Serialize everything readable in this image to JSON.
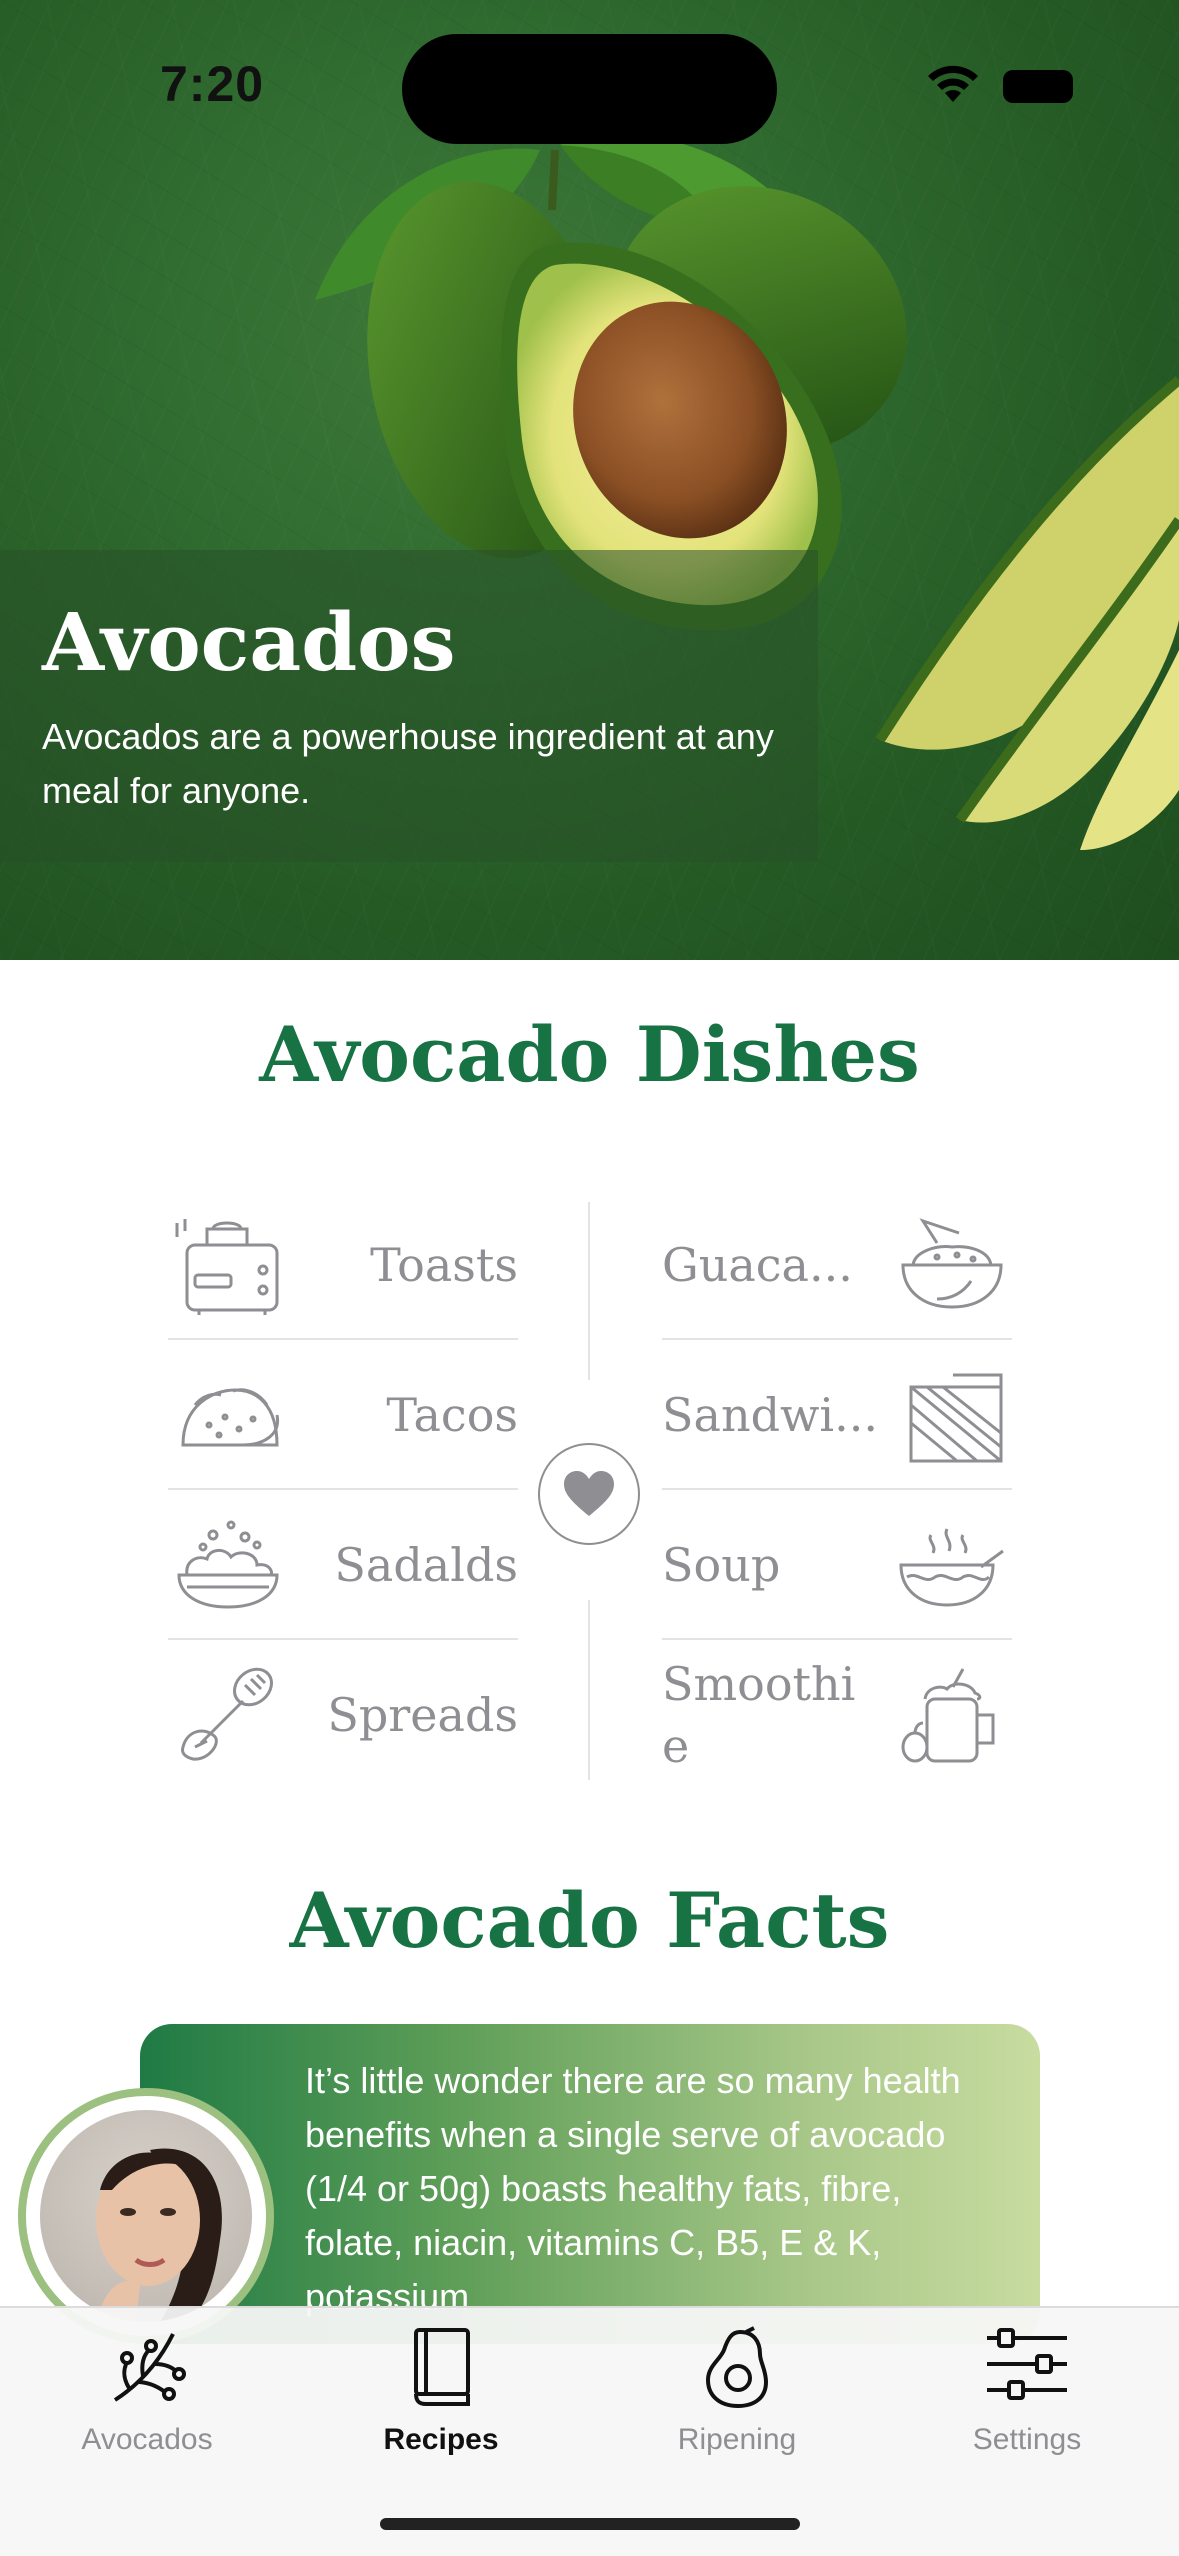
{
  "status_bar": {
    "time": "7:20"
  },
  "hero": {
    "title": "Avocados",
    "description": "Avocados are a powerhouse ingredient at any meal for anyone."
  },
  "dishes": {
    "title": "Avocado Dishes",
    "left": [
      {
        "label": "Toasts",
        "icon": "toaster-icon"
      },
      {
        "label": "Tacos",
        "icon": "taco-icon"
      },
      {
        "label": "Sadalds",
        "icon": "salad-bowl-icon"
      },
      {
        "label": "Spreads",
        "icon": "spread-knife-icon"
      }
    ],
    "right": [
      {
        "label": "Guaca...",
        "icon": "guacamole-bowl-icon"
      },
      {
        "label": "Sandwi...",
        "icon": "sandwich-icon"
      },
      {
        "label": "Soup",
        "icon": "soup-bowl-icon"
      },
      {
        "label": "Smoothi e",
        "icon": "smoothie-jar-icon"
      }
    ],
    "center_icon": "heart-icon"
  },
  "facts": {
    "title": "Avocado Facts",
    "text": "It’s little wonder there are so many health benefits when a single serve of avocado (1/4 or 50g) boasts healthy fats, fibre, folate, niacin, vitamins C, B5, E & K, potassium"
  },
  "tabs": [
    {
      "label": "Avocados",
      "icon": "branch-icon",
      "active": false
    },
    {
      "label": "Recipes",
      "icon": "book-icon",
      "active": true
    },
    {
      "label": "Ripening",
      "icon": "avocado-icon",
      "active": false
    },
    {
      "label": "Settings",
      "icon": "sliders-icon",
      "active": false
    }
  ],
  "colors": {
    "accent_green": "#177244",
    "inactive_gray": "#8e8e93",
    "card_gradient_start": "#1f7a44",
    "card_gradient_end": "#c8dca0"
  }
}
